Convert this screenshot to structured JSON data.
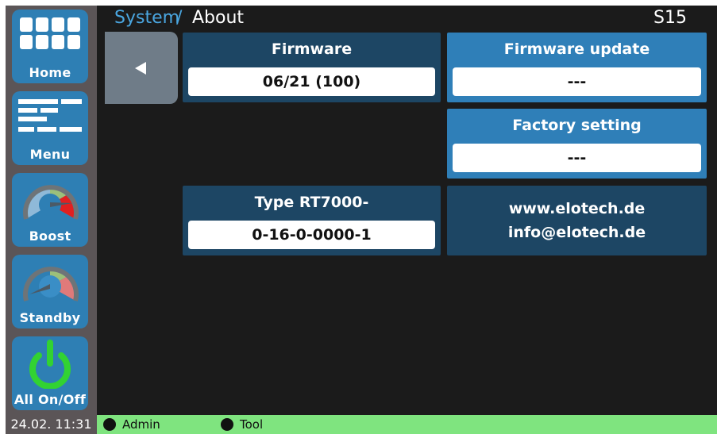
{
  "sidebar": {
    "items": [
      {
        "label": "Home",
        "icon": "home-grid-icon"
      },
      {
        "label": "Menu",
        "icon": "menu-bars-icon"
      },
      {
        "label": "Boost",
        "icon": "boost-gauge-icon"
      },
      {
        "label": "Standby",
        "icon": "standby-gauge-icon"
      },
      {
        "label": "All On/Off",
        "icon": "power-icon"
      }
    ]
  },
  "header": {
    "breadcrumb_system": "System",
    "breadcrumb_separator": "/",
    "breadcrumb_page": "About",
    "screen_id": "S15"
  },
  "panels": {
    "firmware": {
      "title": "Firmware",
      "value": "06/21  (100)"
    },
    "firmware_update": {
      "title": "Firmware update",
      "value": "---"
    },
    "factory_setting": {
      "title": "Factory setting",
      "value": "---"
    },
    "type": {
      "title": "Type RT7000-",
      "value": "0-16-0-0000-1"
    },
    "contact": {
      "website": "www.elotech.de",
      "email": "info@elotech.de"
    }
  },
  "statusbar": {
    "datetime": "24.02. 11:31",
    "user": "Admin",
    "mode": "Tool"
  },
  "colors": {
    "accent_blue": "#2e7fb4",
    "panel_dark": "#1d4664",
    "status_green": "#7fe47f",
    "sidebar_gray": "#5b5557"
  }
}
